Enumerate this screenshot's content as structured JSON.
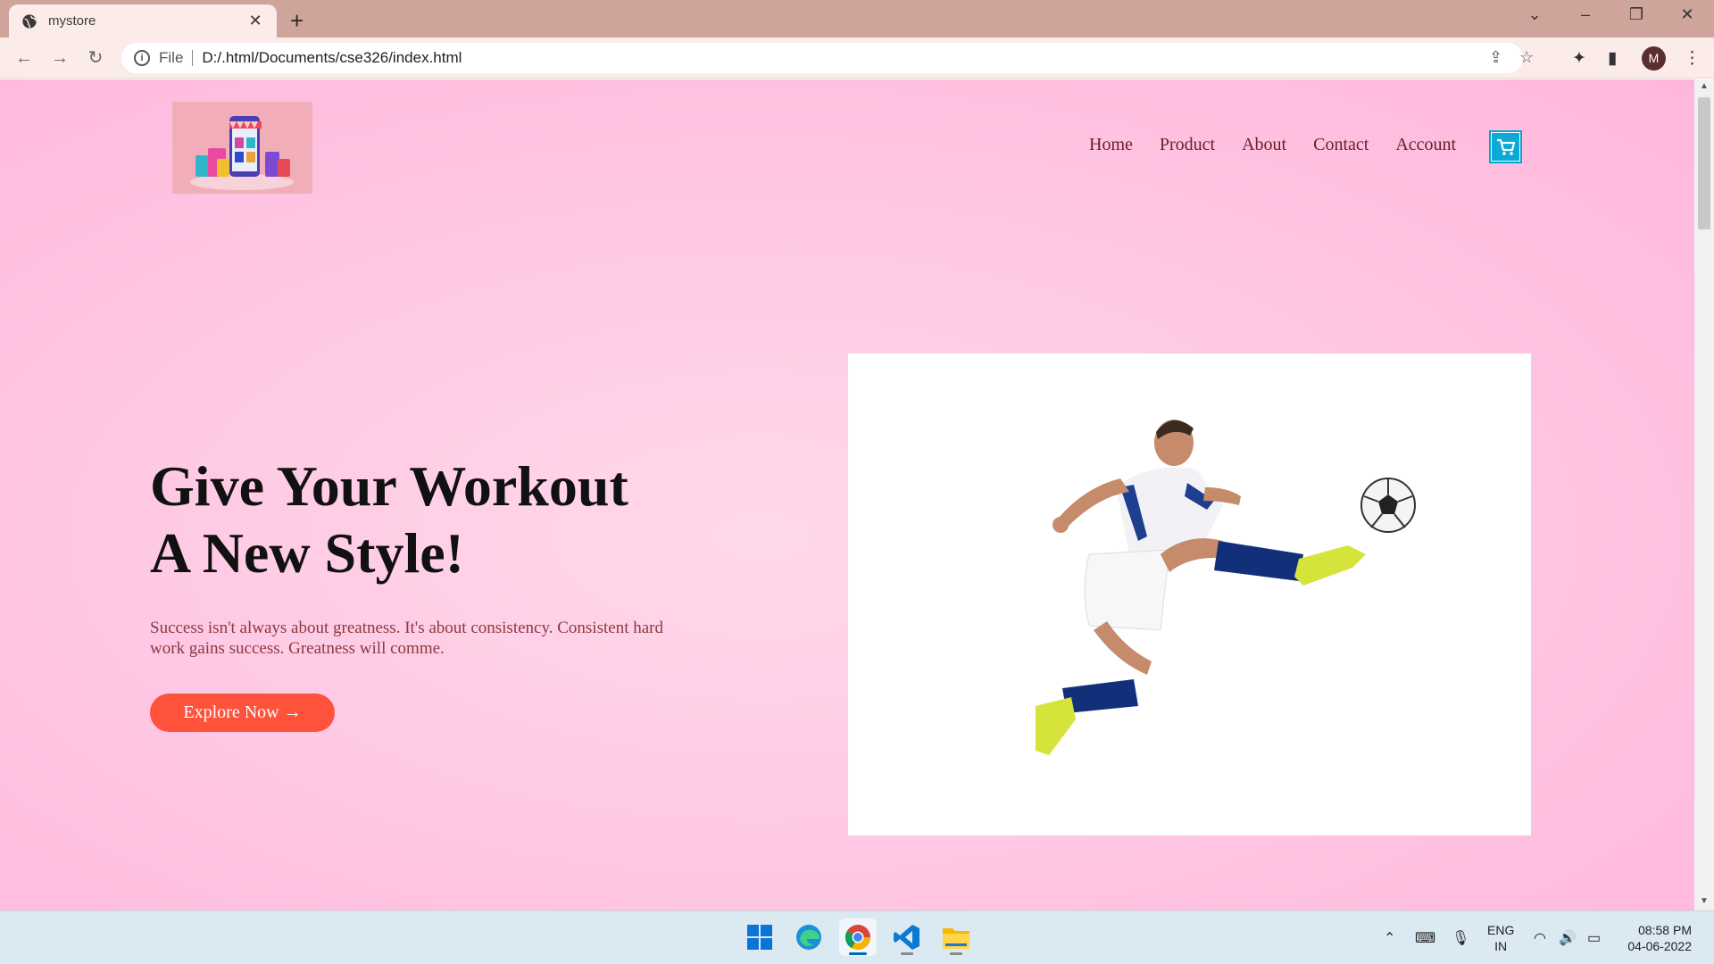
{
  "browser": {
    "tab_title": "mystore",
    "address": {
      "scheme": "File",
      "url": "D:/.html/Documents/cse326/index.html"
    },
    "profile_initial": "M"
  },
  "site": {
    "nav": [
      "Home",
      "Product",
      "About",
      "Contact",
      "Account"
    ],
    "hero": {
      "headline_line1": "Give Your Workout",
      "headline_line2": "A New Style!",
      "subtext": "Success isn't always about greatness. It's about consistency. Consistent hard work gains success. Greatness will comme.",
      "cta_label": "Explore Now →"
    }
  },
  "taskbar": {
    "apps": [
      "windows-start",
      "edge",
      "chrome",
      "vscode",
      "file-explorer"
    ],
    "language": {
      "line1": "ENG",
      "line2": "IN"
    },
    "time": "08:58 PM",
    "date": "04-06-2022"
  },
  "colors": {
    "tabbar": "#cfa49a",
    "page_pink": "#ffc6e3",
    "accent_button": "#ff523b",
    "nav_text": "#6a1f23",
    "cart": "#0aa9d6"
  }
}
